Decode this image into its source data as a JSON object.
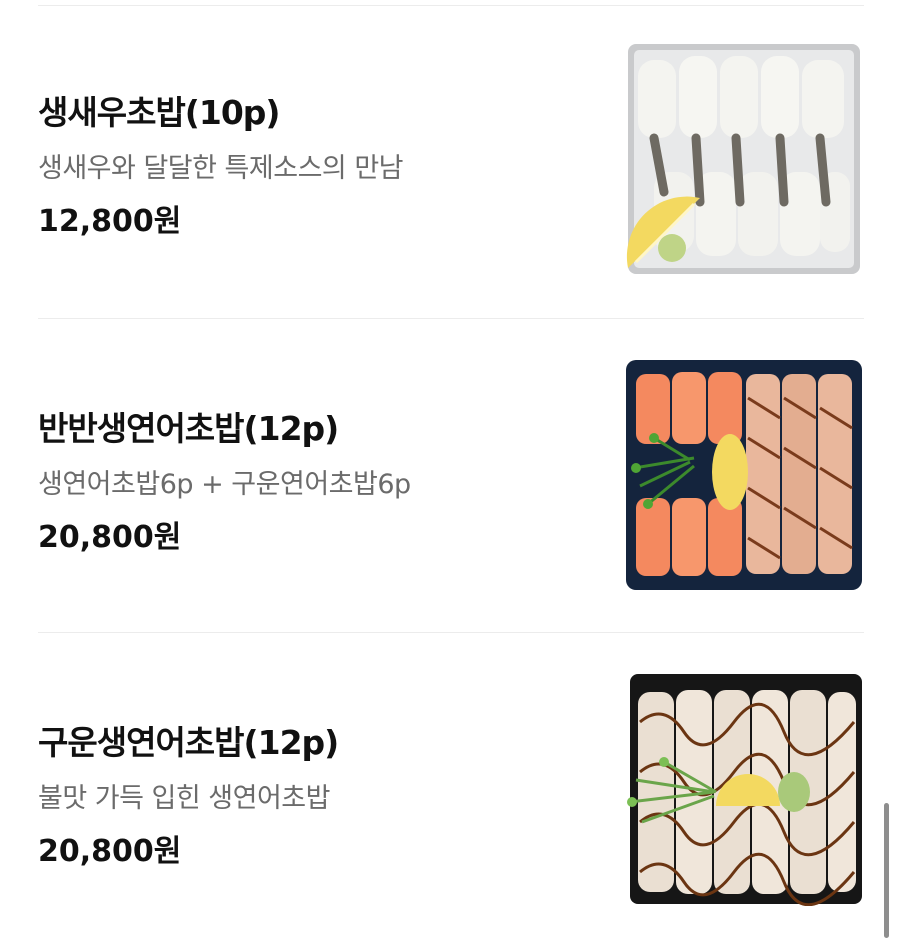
{
  "menu": {
    "items": [
      {
        "name": "생새우초밥(10p)",
        "description": "생새우와 달달한 특제소스의 만남",
        "price": "12,800원",
        "image_icon": "shrimp-sushi-image"
      },
      {
        "name": "반반생연어초밥(12p)",
        "description": "생연어초밥6p + 구운연어초밥6p",
        "price": "20,800원",
        "image_icon": "half-salmon-sushi-image"
      },
      {
        "name": "구운생연어초밥(12p)",
        "description": "불맛 가득 입힌 생연어초밥",
        "price": "20,800원",
        "image_icon": "seared-salmon-sushi-image"
      }
    ]
  },
  "colors": {
    "divider": "#ececec",
    "description": "#6b6b6b",
    "salmon": "#f4895f",
    "tray_dark": "#14243d"
  }
}
